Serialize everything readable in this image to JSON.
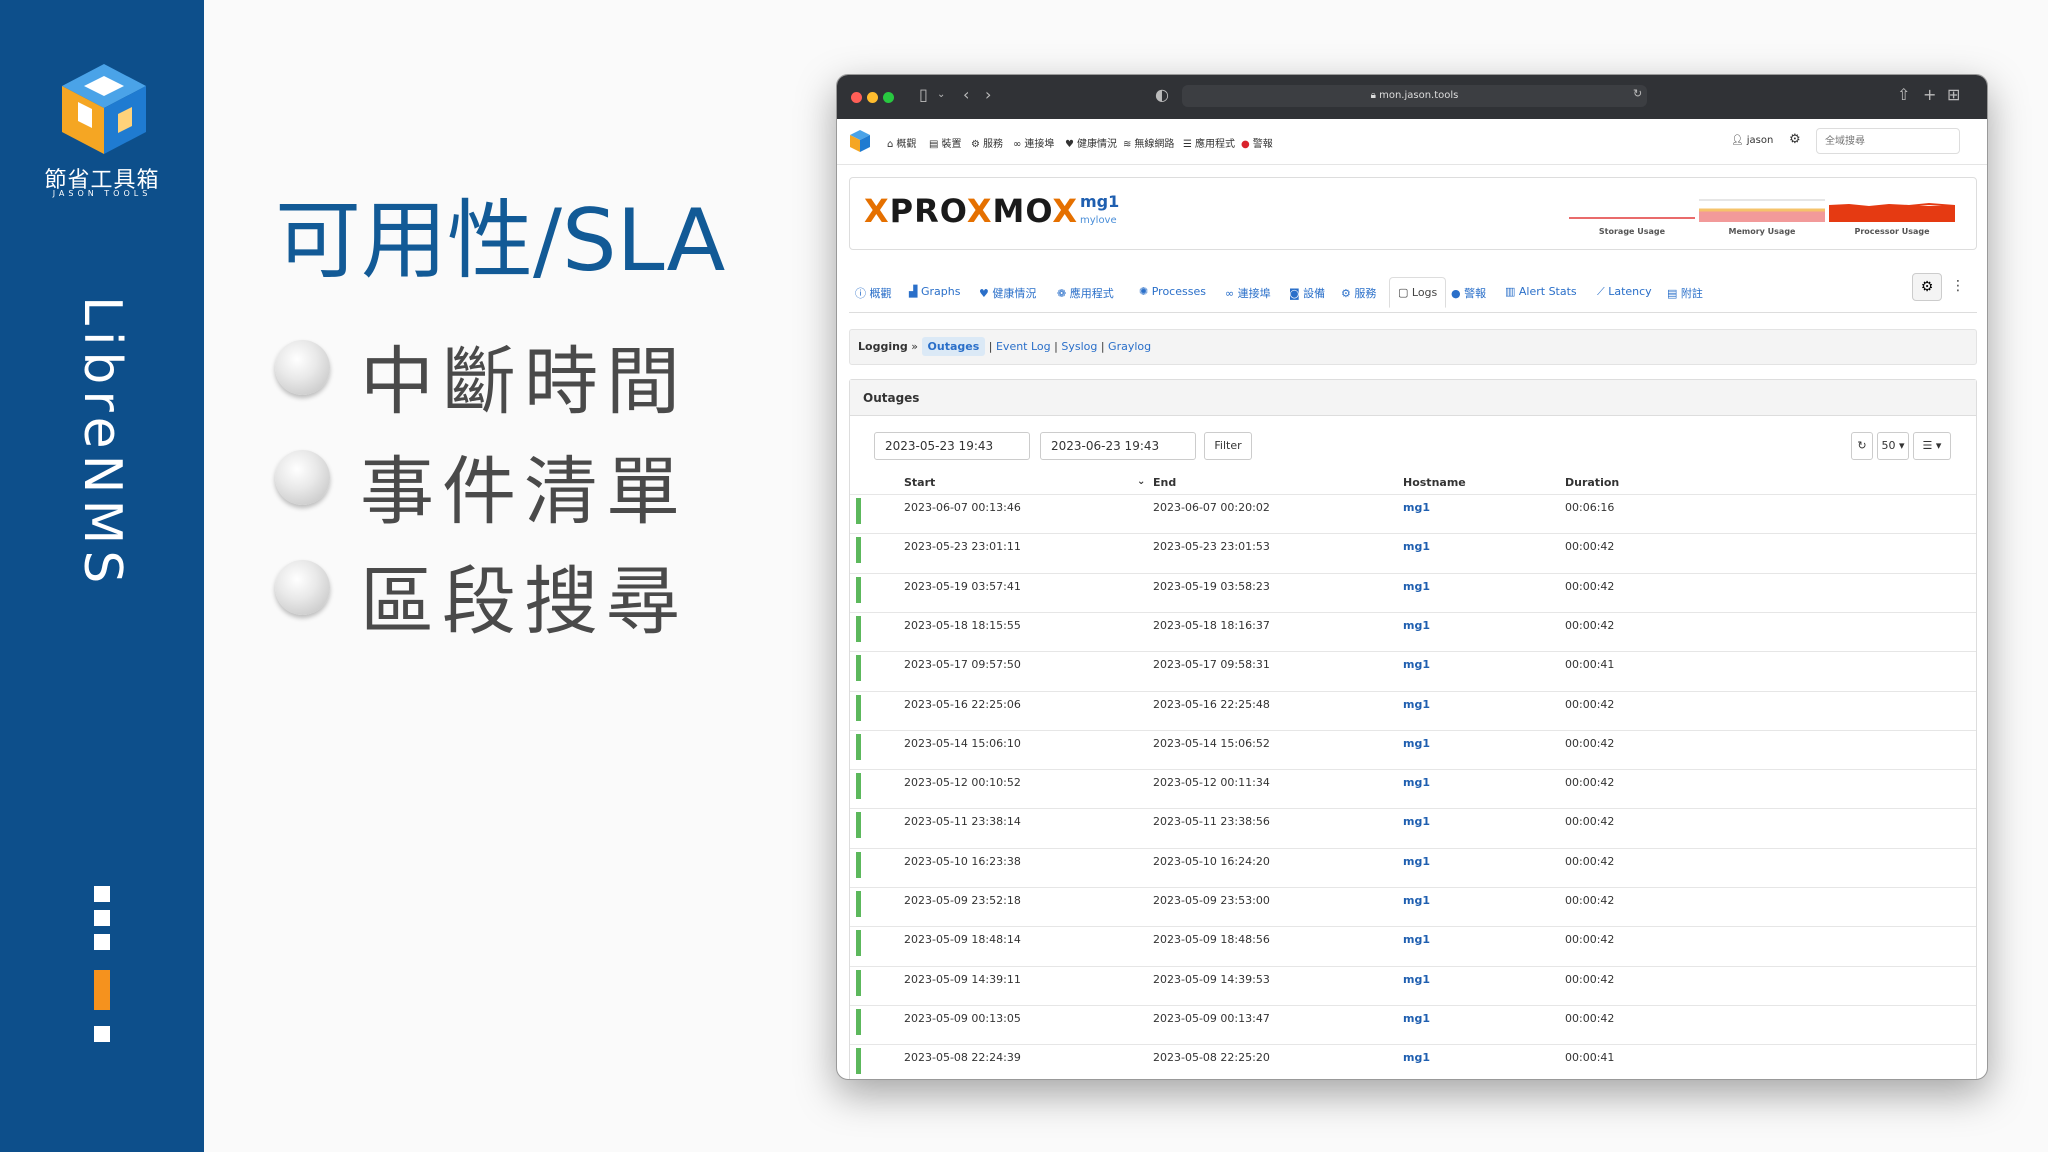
{
  "slide": {
    "brand_name": "節省工具箱",
    "brand_sub": "JASON TOOLS",
    "vertical_title": "LibreNMS",
    "title": "可用性/SLA",
    "bullets": [
      "中斷時間",
      "事件清單",
      "區段搜尋"
    ],
    "colors": {
      "sidebar": "#0d4f8b",
      "title": "#125a96",
      "accent": "#f5921e"
    }
  },
  "browser": {
    "url": "mon.jason.tools",
    "nav": [
      "概觀",
      "裝置",
      "服務",
      "連接埠",
      "健康情況",
      "無線網路",
      "應用程式",
      "警報"
    ],
    "user": "jason",
    "search_placeholder": "全域搜尋",
    "device": {
      "logo_left": "PRO",
      "logo_x": "X",
      "logo_mid": "MO",
      "logo_right": "X",
      "name": "mg1",
      "subtitle": "mylove",
      "graphs": [
        "Storage Usage",
        "Memory Usage",
        "Processor Usage"
      ]
    },
    "tabs": [
      "概觀",
      "Graphs",
      "健康情況",
      "應用程式",
      "Processes",
      "連接埠",
      "設備",
      "服務",
      "Logs",
      "警報",
      "Alert Stats",
      "Latency",
      "附註"
    ],
    "breadcrumb": {
      "root": "Logging",
      "current": "Outages",
      "links": [
        "Event Log",
        "Syslog",
        "Graylog"
      ]
    },
    "panel": {
      "title": "Outages",
      "from": "2023-05-23 19:43",
      "to": "2023-06-23 19:43",
      "filter_label": "Filter",
      "page_size": "50",
      "columns": [
        "Start",
        "End",
        "Hostname",
        "Duration"
      ],
      "rows": [
        [
          "2023-06-07 00:13:46",
          "2023-06-07 00:20:02",
          "mg1",
          "00:06:16"
        ],
        [
          "2023-05-23 23:01:11",
          "2023-05-23 23:01:53",
          "mg1",
          "00:00:42"
        ],
        [
          "2023-05-19 03:57:41",
          "2023-05-19 03:58:23",
          "mg1",
          "00:00:42"
        ],
        [
          "2023-05-18 18:15:55",
          "2023-05-18 18:16:37",
          "mg1",
          "00:00:42"
        ],
        [
          "2023-05-17 09:57:50",
          "2023-05-17 09:58:31",
          "mg1",
          "00:00:41"
        ],
        [
          "2023-05-16 22:25:06",
          "2023-05-16 22:25:48",
          "mg1",
          "00:00:42"
        ],
        [
          "2023-05-14 15:06:10",
          "2023-05-14 15:06:52",
          "mg1",
          "00:00:42"
        ],
        [
          "2023-05-12 00:10:52",
          "2023-05-12 00:11:34",
          "mg1",
          "00:00:42"
        ],
        [
          "2023-05-11 23:38:14",
          "2023-05-11 23:38:56",
          "mg1",
          "00:00:42"
        ],
        [
          "2023-05-10 16:23:38",
          "2023-05-10 16:24:20",
          "mg1",
          "00:00:42"
        ],
        [
          "2023-05-09 23:52:18",
          "2023-05-09 23:53:00",
          "mg1",
          "00:00:42"
        ],
        [
          "2023-05-09 18:48:14",
          "2023-05-09 18:48:56",
          "mg1",
          "00:00:42"
        ],
        [
          "2023-05-09 14:39:11",
          "2023-05-09 14:39:53",
          "mg1",
          "00:00:42"
        ],
        [
          "2023-05-09 00:13:05",
          "2023-05-09 00:13:47",
          "mg1",
          "00:00:42"
        ],
        [
          "2023-05-08 22:24:39",
          "2023-05-08 22:25:20",
          "mg1",
          "00:00:41"
        ]
      ]
    }
  }
}
